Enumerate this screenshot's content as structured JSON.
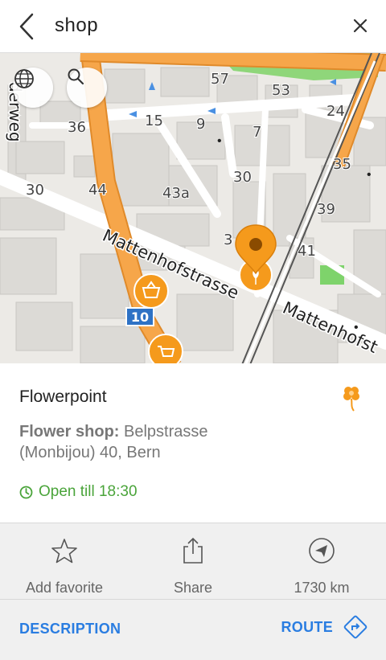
{
  "topbar": {
    "query": "shop",
    "back_icon": "chevron-left-icon",
    "close_icon": "close-icon"
  },
  "map": {
    "globe_icon": "globe-icon",
    "search_icon": "search-icon",
    "street_name": "Mattenhofstrasse",
    "street_name_2": "Mattenhofst",
    "street_partial": "derweg",
    "route_shield": "10",
    "house_numbers": [
      "57",
      "53",
      "24",
      "36",
      "15",
      "9",
      "7",
      "35",
      "30",
      "30",
      "44",
      "43a",
      "39",
      "41",
      "3"
    ],
    "colors": {
      "primary_road": "#f6a64a",
      "marker": "#f59a1c",
      "green": "#7ed36b",
      "shield": "#2e72c5"
    }
  },
  "place": {
    "name": "Flowerpoint",
    "category": "Flower shop:",
    "address": "Belpstrasse (Monbijou) 40, Bern",
    "hours": "Open till 18:30",
    "icon": "flower-icon"
  },
  "actions": [
    {
      "label": "Add favorite",
      "icon": "star-icon"
    },
    {
      "label": "Share",
      "icon": "share-icon"
    },
    {
      "label": "1730 km",
      "icon": "compass-icon"
    }
  ],
  "bottom": {
    "description": "DESCRIPTION",
    "route": "ROUTE",
    "route_icon": "route-icon"
  },
  "colors": {
    "accent": "#2a7de1",
    "open": "#4aa43a"
  }
}
